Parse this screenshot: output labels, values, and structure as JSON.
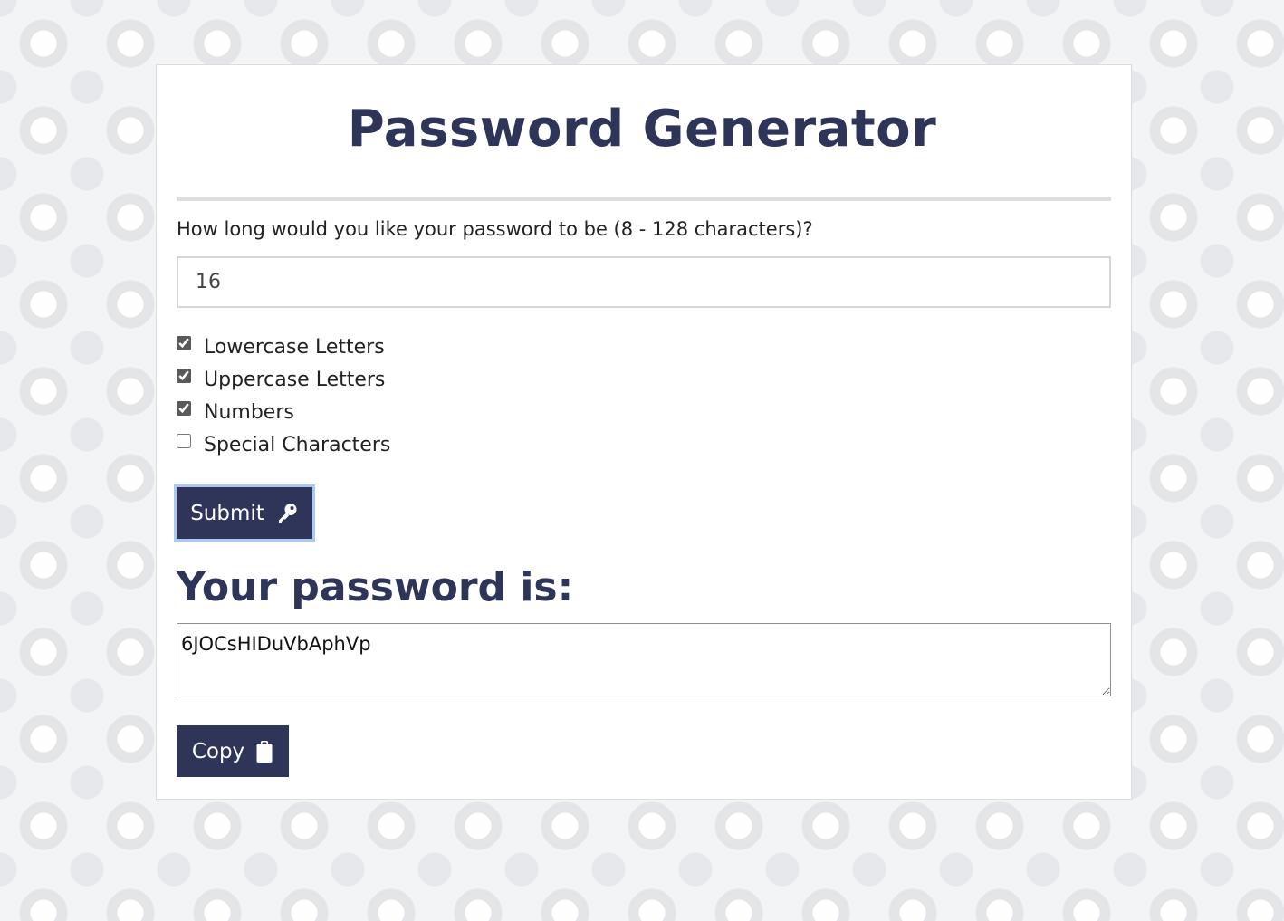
{
  "header": {
    "title": "Password Generator"
  },
  "form": {
    "length_question": "How long would you like your password to be (8 - 128 characters)?",
    "length_value": "16",
    "options": [
      {
        "label": "Lowercase Letters",
        "checked": true
      },
      {
        "label": "Uppercase Letters",
        "checked": true
      },
      {
        "label": "Numbers",
        "checked": true
      },
      {
        "label": "Special Characters",
        "checked": false
      }
    ],
    "submit_label": "Submit",
    "submit_icon": "key-icon"
  },
  "result": {
    "heading": "Your password is:",
    "password": "6JOCsHIDuVbAphVp",
    "copy_label": "Copy",
    "copy_icon": "clipboard-icon"
  },
  "colors": {
    "primary": "#2e3559",
    "focus_ring": "#a9c8f2",
    "divider": "#dddddd"
  }
}
